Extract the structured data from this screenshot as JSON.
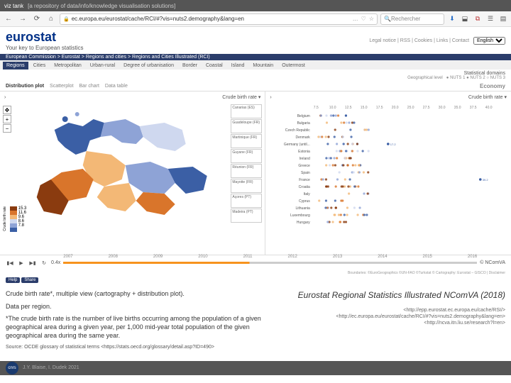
{
  "topbar": {
    "title": "viz tank",
    "subtitle": "[a repository of data/info/knowledge visualisation solutions]"
  },
  "browser": {
    "url": "ec.europa.eu/eurostat/cache/RCI/#?vis=nuts2.demography&lang=en",
    "search_placeholder": "Rechercher",
    "icons": {
      "back": "←",
      "forward": "→",
      "reload": "⟳",
      "home": "⌂",
      "lock": "🔒",
      "dots": "…",
      "heart": "♡",
      "download": "⬇",
      "ext1": "⬓",
      "ext2": "⧉",
      "ext3": "☰",
      "ext4": "▤"
    }
  },
  "header": {
    "brand": "eurostat",
    "tagline": "Your key to European statistics",
    "links": "Legal notice  |  RSS  |  Cookies  |  Links  |  Contact",
    "lang": "English"
  },
  "breadcrumb": "European Commission  >  Eurostat  >  Regions and cities  >  Regions and Cities Illustrated (RCI)",
  "tabs": [
    "Regions",
    "Cities",
    "Metropolitan",
    "Urban-rural",
    "Degree of urbanisation",
    "Border",
    "Coastal",
    "Island",
    "Mountain",
    "Outermost"
  ],
  "active_tab": 0,
  "stat": {
    "label": "Statistical domains",
    "geo": "Geographical level",
    "nuts": "● NUTS 1   ● NUTS 2   ○ NUTS 3"
  },
  "subtabs": {
    "items": [
      "Distribution plot",
      "Scatterplot",
      "Bar chart",
      "Data table"
    ],
    "active": 0,
    "economy": "Economy"
  },
  "map": {
    "dropdown": "Crude birth rate ▾",
    "chev": "›",
    "legend_label": "Crude birth rate",
    "legend": [
      {
        "v": "15.3",
        "c": "#8a3b0f"
      },
      {
        "v": "11.6",
        "c": "#d9752b"
      },
      {
        "v": "9.6",
        "c": "#f3b876"
      },
      {
        "v": "8.6",
        "c": "#cfd8ef"
      },
      {
        "v": "7.8",
        "c": "#8ea3d6"
      },
      {
        "v": "",
        "c": "#3b5fa5"
      }
    ],
    "islands": [
      "Canarias (ES)",
      "Guadeloupe (FR)",
      "Martinique (FR)",
      "Guyane (FR)",
      "Réunion (FR)",
      "Mayotte (FR)",
      "Açores (PT)",
      "Madeira (PT)"
    ]
  },
  "plot": {
    "dropdown": "Crude birth rate ▾",
    "x_ticks": [
      "7.5",
      "10.0",
      "12.5",
      "15.0",
      "17.5",
      "20.0",
      "25.0",
      "27.5",
      "30.0",
      "35.0",
      "37.5",
      "40.0"
    ],
    "countries": [
      "Belgium",
      "Bulgaria",
      "Czech Republic",
      "Denmark",
      "Germany (until...",
      "Estonia",
      "Ireland",
      "Greece",
      "Spain",
      "France",
      "Croatia",
      "Italy",
      "Cyprus",
      "Lithuania",
      "Luxembourg",
      "Hungary"
    ]
  },
  "timeline": {
    "years": [
      "2007",
      "2008",
      "2009",
      "2010",
      "2011",
      "2012",
      "2013",
      "2014",
      "2015",
      "2016"
    ],
    "speed": "0.4x",
    "credits": "© NComVA"
  },
  "boundaries": "Boundaries: ©EuroGeographics ©UN-FAO ©Turkstat © Cartography: Eurostat – GISCO  |  Disclaimer",
  "mini": [
    "Help",
    "Share"
  ],
  "desc": {
    "p1": "Crude birth rate*, multiple view (cartography + distribution plot).",
    "p2": "Data per region.",
    "p3": "*The crude birth rate is the number of live births occurring among the population of a given geographical area during a given year, per 1,000 mid-year total population of the given geographical area during the same year.",
    "src": "Source: OCDE glossary of statistical terms <https://stats.oecd.org/glossary/detail.asp?ID=490>",
    "right_title": "Eurostat  Regional Statistics Illustrated NComVA (2018)",
    "url1": "<http://epp.eurostat.ec.europa.eu/cache/RSI/>",
    "url2": "<http://ec.europa.eu/eurostat/cache/RCI/#?vis=nuts2.demography&lang=en>",
    "url3": "<http://ncva.itn.liu.se/research?l=en>"
  },
  "bottom": {
    "logo": "cnrs",
    "authors": "J.Y. Blaise,  I. Dudek 2021"
  }
}
